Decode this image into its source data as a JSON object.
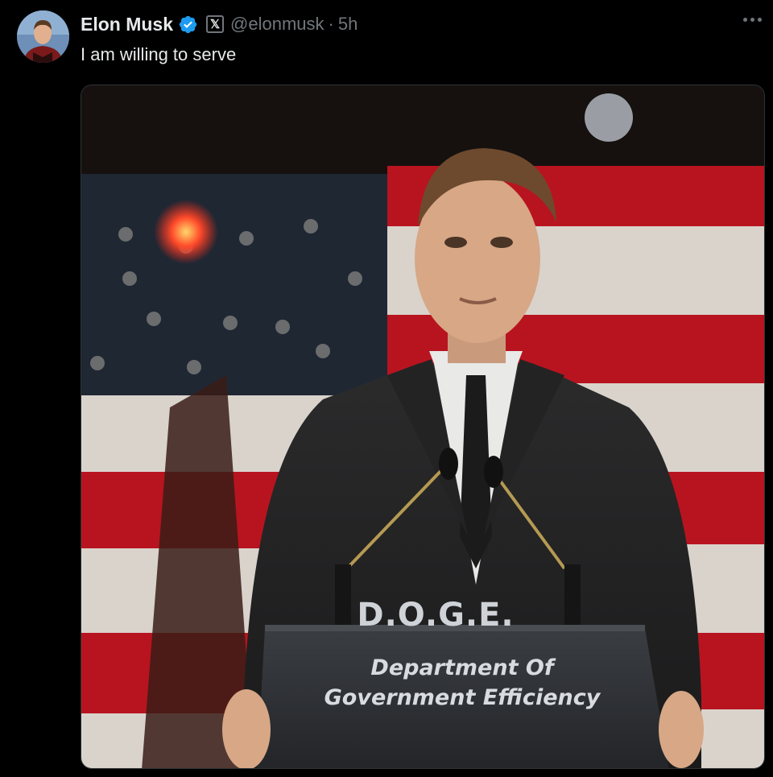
{
  "tweet": {
    "author_name": "Elon Musk",
    "handle": "@elonmusk",
    "separator": "·",
    "time": "5h",
    "affiliation_badge": "𝕏",
    "text": "I am willing to serve"
  },
  "media": {
    "podium_acronym": "D.O.G.E.",
    "podium_line1": "Department Of",
    "podium_line2": "Government Efficiency"
  },
  "icons": {
    "verified": "verified-badge-icon",
    "more": "more-options-icon"
  },
  "colors": {
    "background": "#000000",
    "text_primary": "#e7e9ea",
    "text_secondary": "#71767b",
    "verified_blue": "#1d9bf0",
    "flag_red": "#b8141f"
  }
}
